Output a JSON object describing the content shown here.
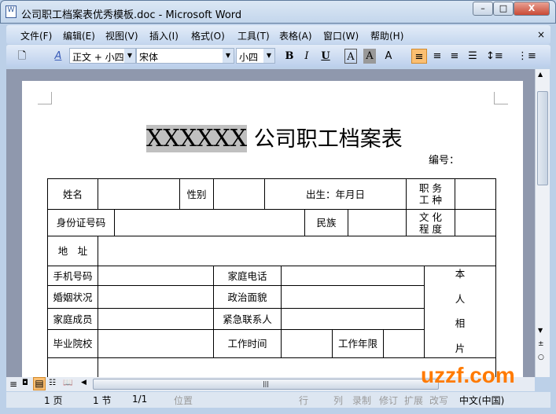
{
  "window": {
    "title": "公司职工档案表优秀模板.doc - Microsoft Word",
    "min": "–",
    "max": "□",
    "close": "X"
  },
  "menu": [
    "文件(F)",
    "编辑(E)",
    "视图(V)",
    "插入(I)",
    "格式(O)",
    "工具(T)",
    "表格(A)",
    "窗口(W)",
    "帮助(H)"
  ],
  "menu_close": "×",
  "toolbar": {
    "style": "正文 + 小四",
    "font": "宋体",
    "size": "小四",
    "bold": "B",
    "italic": "I",
    "underline": "U",
    "char_border": "A",
    "char_shade": "A",
    "scale": "A"
  },
  "document": {
    "title_highlight": "XXXXXX",
    "title_rest": " 公司职工档案表",
    "number_label": "编号：",
    "cells": {
      "name": "姓名",
      "gender": "性别",
      "birth": "出生：年月日",
      "job1": "职 务",
      "job2": "工 种",
      "id": "身份证号码",
      "ethnic": "民族",
      "edu1": "文 化",
      "edu2": "程 度",
      "address": "地　址",
      "mobile": "手机号码",
      "home_phone": "家庭电话",
      "marital": "婚姻状况",
      "political": "政治面貌",
      "family": "家庭成员",
      "emergency": "紧急联系人",
      "school": "毕业院校",
      "work_time": "工作时间",
      "work_years": "工作年限",
      "photo": [
        "本",
        "人",
        "相",
        "片"
      ]
    }
  },
  "status": {
    "page": "1 页",
    "section": "1 节",
    "pages": "1/1",
    "position": "位置",
    "line": "行",
    "col": "列",
    "rec": "录制",
    "trk": "修订",
    "ext": "扩展",
    "ovr": "改写",
    "lang": "中文(中国)"
  },
  "watermark": "uzzf.com"
}
